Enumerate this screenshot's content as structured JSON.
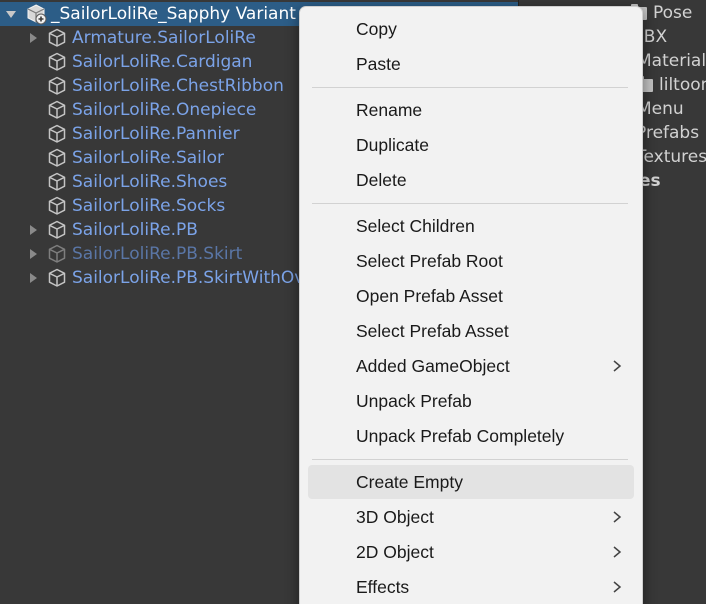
{
  "hierarchy": {
    "root": {
      "label": "_SailorLoliRe_Sapphy Variant",
      "expanded": true
    },
    "items": [
      {
        "label": "Armature.SailorLoliRe",
        "has_children": true,
        "disabled": false
      },
      {
        "label": "SailorLoliRe.Cardigan",
        "has_children": false,
        "disabled": false
      },
      {
        "label": "SailorLoliRe.ChestRibbon",
        "has_children": false,
        "disabled": false
      },
      {
        "label": "SailorLoliRe.Onepiece",
        "has_children": false,
        "disabled": false
      },
      {
        "label": "SailorLoliRe.Pannier",
        "has_children": false,
        "disabled": false
      },
      {
        "label": "SailorLoliRe.Sailor",
        "has_children": false,
        "disabled": false
      },
      {
        "label": "SailorLoliRe.Shoes",
        "has_children": false,
        "disabled": false
      },
      {
        "label": "SailorLoliRe.Socks",
        "has_children": false,
        "disabled": false
      },
      {
        "label": "SailorLoliRe.PB",
        "has_children": true,
        "disabled": false
      },
      {
        "label": "SailorLoliRe.PB.Skirt",
        "has_children": true,
        "disabled": true
      },
      {
        "label": "SailorLoliRe.PB.SkirtWithOverskirt",
        "has_children": true,
        "disabled": false
      }
    ]
  },
  "project": {
    "items": [
      {
        "label": "Pose",
        "icon": "folder-icon",
        "bold": false
      },
      {
        "label": "FBX",
        "icon": "",
        "bold": false
      },
      {
        "label": "Material",
        "icon": "",
        "bold": false
      },
      {
        "label": "liltoon",
        "icon": "folder-icon",
        "bold": false
      },
      {
        "label": "Menu",
        "icon": "",
        "bold": false
      },
      {
        "label": "Prefabs",
        "icon": "",
        "bold": false
      },
      {
        "label": "Textures",
        "icon": "",
        "bold": false
      },
      {
        "label": "es",
        "icon": "",
        "bold": true
      }
    ]
  },
  "context_menu": {
    "groups": [
      [
        {
          "label": "Copy",
          "submenu": false
        },
        {
          "label": "Paste",
          "submenu": false
        }
      ],
      [
        {
          "label": "Rename",
          "submenu": false
        },
        {
          "label": "Duplicate",
          "submenu": false
        },
        {
          "label": "Delete",
          "submenu": false
        }
      ],
      [
        {
          "label": "Select Children",
          "submenu": false
        },
        {
          "label": "Select Prefab Root",
          "submenu": false
        },
        {
          "label": "Open Prefab Asset",
          "submenu": false
        },
        {
          "label": "Select Prefab Asset",
          "submenu": false
        },
        {
          "label": "Added GameObject",
          "submenu": true
        },
        {
          "label": "Unpack Prefab",
          "submenu": false
        },
        {
          "label": "Unpack Prefab Completely",
          "submenu": false
        }
      ],
      [
        {
          "label": "Create Empty",
          "submenu": false,
          "hover": true
        },
        {
          "label": "3D Object",
          "submenu": true
        },
        {
          "label": "2D Object",
          "submenu": true
        },
        {
          "label": "Effects",
          "submenu": true
        }
      ]
    ]
  },
  "colors": {
    "panel_bg": "#383838",
    "selection": "#2c5d87",
    "prefab_text": "#7ba3e8",
    "menu_bg": "#f2f2f2",
    "menu_hover": "#e3e3e3"
  }
}
